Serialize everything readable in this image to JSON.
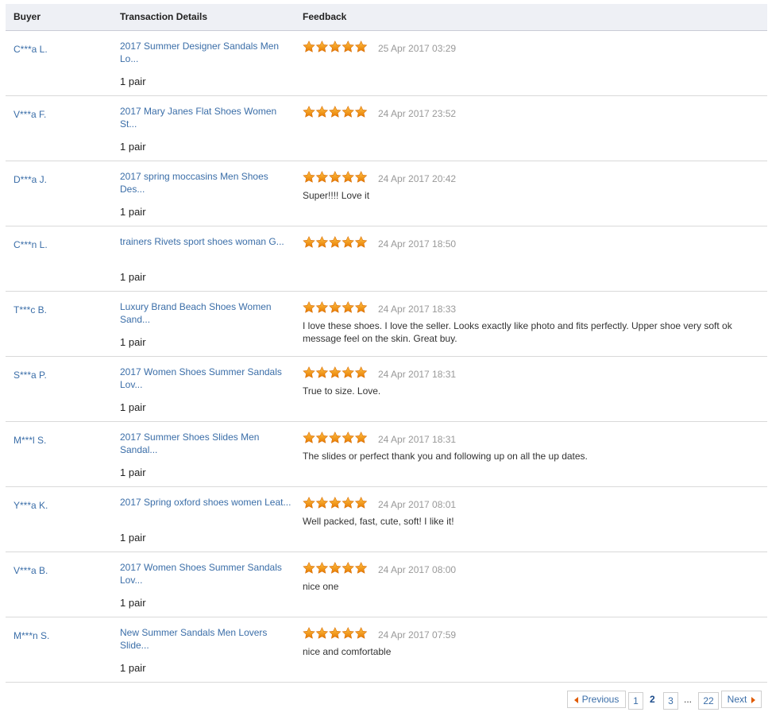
{
  "table": {
    "headers": {
      "buyer": "Buyer",
      "details": "Transaction Details",
      "feedback": "Feedback"
    },
    "rows": [
      {
        "buyer": "C***a L.",
        "product": "2017 Summer Designer Sandals Men Lo...",
        "qty": "1 pair",
        "rating": 5,
        "date": "25 Apr 2017 03:29",
        "feedback": ""
      },
      {
        "buyer": "V***a F.",
        "product": "2017 Mary Janes Flat Shoes Women St...",
        "qty": "1 pair",
        "rating": 5,
        "date": "24 Apr 2017 23:52",
        "feedback": ""
      },
      {
        "buyer": "D***a J.",
        "product": "2017 spring moccasins Men Shoes Des...",
        "qty": "1 pair",
        "rating": 5,
        "date": "24 Apr 2017 20:42",
        "feedback": "Super!!!! Love it"
      },
      {
        "buyer": "C***n L.",
        "product": "trainers Rivets sport shoes woman G...",
        "qty": "1 pair",
        "rating": 5,
        "date": "24 Apr 2017 18:50",
        "feedback": ""
      },
      {
        "buyer": "T***c B.",
        "product": "Luxury Brand Beach Shoes Women Sand...",
        "qty": "1 pair",
        "rating": 5,
        "date": "24 Apr 2017 18:33",
        "feedback": "I love these shoes. I love the seller. Looks exactly like photo and fits perfectly. Upper shoe very soft ok message feel on the skin. Great buy."
      },
      {
        "buyer": "S***a P.",
        "product": "2017 Women Shoes Summer Sandals Lov...",
        "qty": "1 pair",
        "rating": 5,
        "date": "24 Apr 2017 18:31",
        "feedback": "True to size. Love."
      },
      {
        "buyer": "M***l S.",
        "product": "2017 Summer Shoes Slides Men Sandal...",
        "qty": "1 pair",
        "rating": 5,
        "date": "24 Apr 2017 18:31",
        "feedback": "The slides or perfect thank you and following up on all the up dates."
      },
      {
        "buyer": "Y***a K.",
        "product": "2017 Spring oxford shoes women Leat...",
        "qty": "1 pair",
        "rating": 5,
        "date": "24 Apr 2017 08:01",
        "feedback": "Well packed, fast, cute, soft! I like it!"
      },
      {
        "buyer": "V***a B.",
        "product": "2017 Women Shoes Summer Sandals Lov...",
        "qty": "1 pair",
        "rating": 5,
        "date": "24 Apr 2017 08:00",
        "feedback": "nice one"
      },
      {
        "buyer": "M***n S.",
        "product": "New Summer Sandals Men Lovers Slide...",
        "qty": "1 pair",
        "rating": 5,
        "date": "24 Apr 2017 07:59",
        "feedback": "nice and comfortable"
      }
    ]
  },
  "pagination": {
    "previous": "Previous",
    "pages": [
      "1",
      "2",
      "3"
    ],
    "current": "2",
    "ellipsis": "...",
    "last": "22",
    "next": "Next"
  },
  "colors": {
    "link": "#3b6ea8",
    "star": "#f39c12",
    "arrow": "#e05a00",
    "header_bg": "#eef0f5"
  }
}
